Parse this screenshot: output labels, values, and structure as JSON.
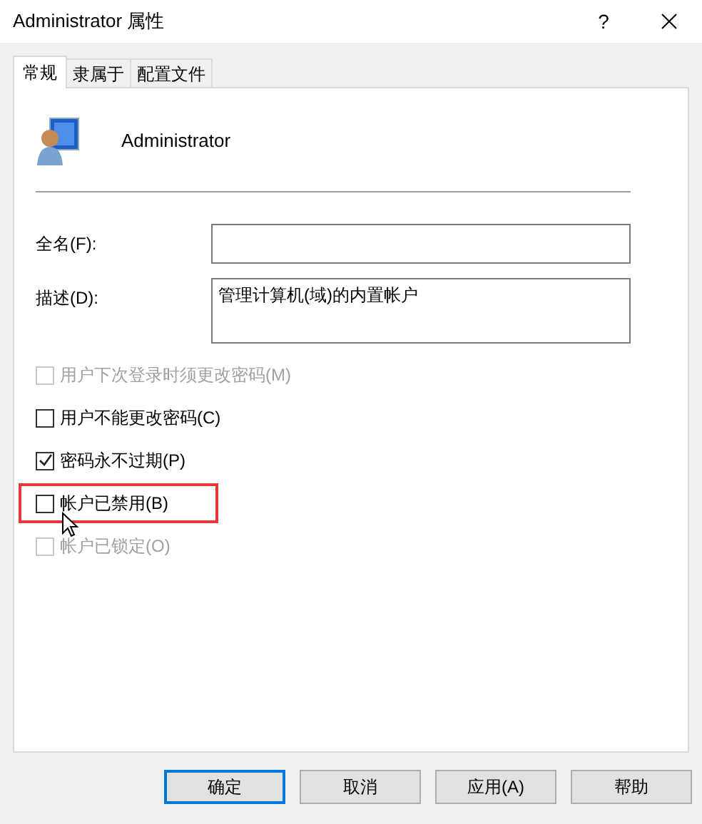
{
  "window": {
    "title": "Administrator 属性",
    "help": "?"
  },
  "tabs": [
    {
      "label": "常规",
      "selected": true
    },
    {
      "label": "隶属于",
      "selected": false
    },
    {
      "label": "配置文件",
      "selected": false
    }
  ],
  "user": {
    "name": "Administrator"
  },
  "fields": [
    {
      "label": "全名(F):",
      "kind": "line"
    },
    {
      "label": "描述(D):",
      "value": "管理计算机(域)的内置帐户",
      "kind": "area"
    }
  ],
  "options": [
    {
      "label": "用户下次登录时须更改密码(M)",
      "checked": false,
      "disabled": true,
      "highlighted": false
    },
    {
      "label": "用户不能更改密码(C)",
      "checked": false,
      "disabled": false,
      "highlighted": false
    },
    {
      "label": "密码永不过期(P)",
      "checked": true,
      "disabled": false,
      "highlighted": false
    },
    {
      "label": "帐户已禁用(B)",
      "checked": false,
      "disabled": false,
      "highlighted": true
    },
    {
      "label": "帐户已锁定(O)",
      "checked": false,
      "disabled": true,
      "highlighted": false
    }
  ],
  "buttons": [
    {
      "label": "确定",
      "default": true
    },
    {
      "label": "取消",
      "default": false
    },
    {
      "label": "应用(A)",
      "default": false
    },
    {
      "label": "帮助",
      "default": false
    }
  ]
}
